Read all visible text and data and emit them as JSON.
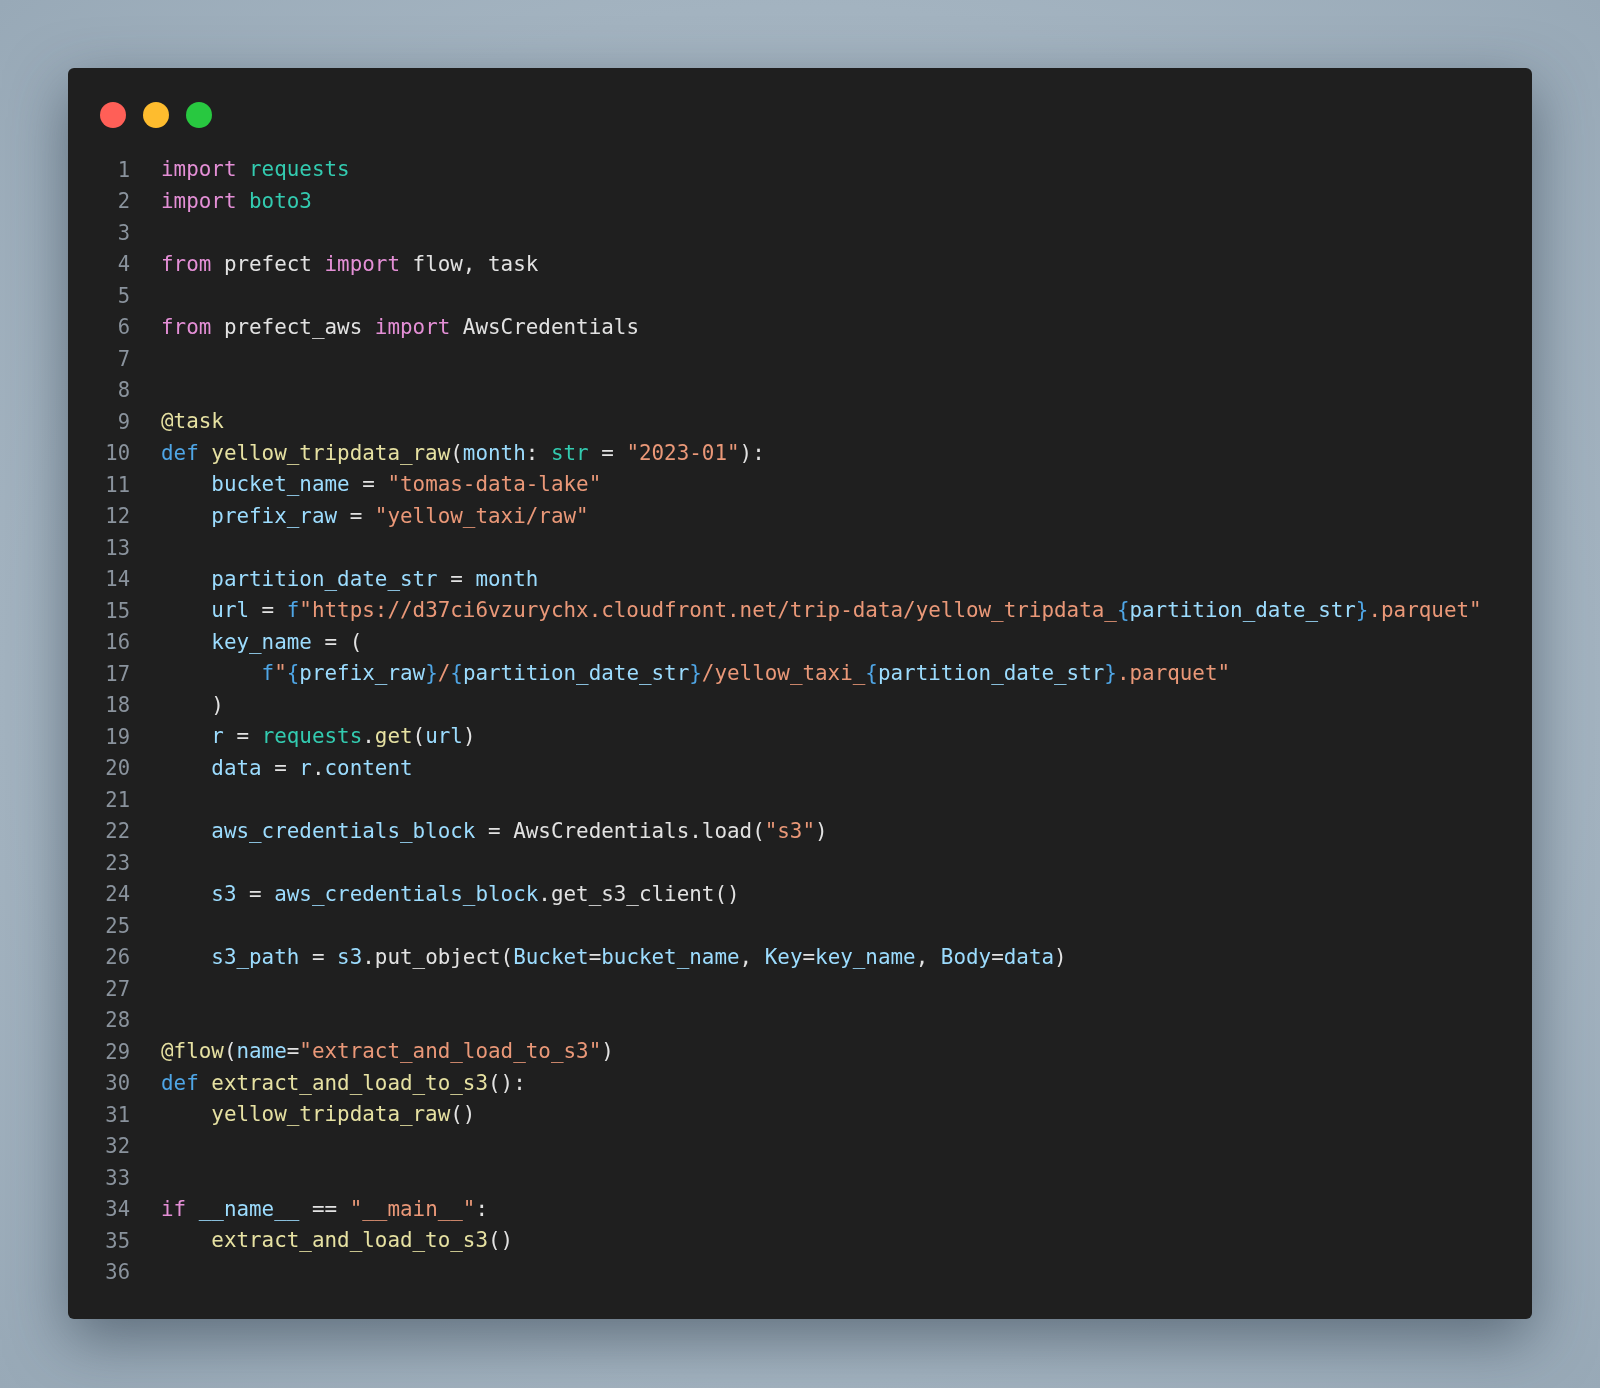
{
  "lines": [
    {
      "number": "1",
      "tokens": [
        {
          "kind": "keyword",
          "text": "import"
        },
        {
          "kind": "module",
          "text": " requests"
        }
      ]
    },
    {
      "number": "2",
      "tokens": [
        {
          "kind": "keyword",
          "text": "import"
        },
        {
          "kind": "module",
          "text": " boto3"
        }
      ]
    },
    {
      "number": "3"
    },
    {
      "number": "4",
      "tokens": [
        {
          "kind": "keyword",
          "text": "from"
        },
        {
          "kind": "plain",
          "text": " prefect "
        },
        {
          "kind": "keyword",
          "text": "import"
        },
        {
          "kind": "plain",
          "text": " flow, task"
        }
      ]
    },
    {
      "number": "5"
    },
    {
      "number": "6",
      "tokens": [
        {
          "kind": "keyword",
          "text": "from"
        },
        {
          "kind": "plain",
          "text": " prefect_aws "
        },
        {
          "kind": "keyword",
          "text": "import"
        },
        {
          "kind": "plain",
          "text": " AwsCredentials"
        }
      ]
    },
    {
      "number": "7"
    },
    {
      "number": "8"
    },
    {
      "number": "9",
      "tokens": [
        {
          "kind": "function",
          "text": "@task"
        }
      ]
    },
    {
      "number": "10",
      "tokens": [
        {
          "kind": "storage",
          "text": "def"
        },
        {
          "kind": "function",
          "text": " yellow_tripdata_raw"
        },
        {
          "kind": "plain",
          "text": "("
        },
        {
          "kind": "variable",
          "text": "month"
        },
        {
          "kind": "plain",
          "text": ":"
        },
        {
          "kind": "module",
          "text": " str"
        },
        {
          "kind": "plain",
          "text": " = "
        },
        {
          "kind": "string",
          "text": "\"2023-01\""
        },
        {
          "kind": "plain",
          "text": "):"
        }
      ]
    },
    {
      "number": "11",
      "tokens": [
        {
          "kind": "variable",
          "text": "    bucket_name"
        },
        {
          "kind": "plain",
          "text": " = "
        },
        {
          "kind": "string",
          "text": "\"tomas-data-lake\""
        }
      ]
    },
    {
      "number": "12",
      "tokens": [
        {
          "kind": "variable",
          "text": "    prefix_raw"
        },
        {
          "kind": "plain",
          "text": " = "
        },
        {
          "kind": "string",
          "text": "\"yellow_taxi/raw\""
        }
      ]
    },
    {
      "number": "13"
    },
    {
      "number": "14",
      "tokens": [
        {
          "kind": "variable",
          "text": "    partition_date_str"
        },
        {
          "kind": "plain",
          "text": " = "
        },
        {
          "kind": "variable",
          "text": "month"
        }
      ]
    },
    {
      "number": "15",
      "tokens": [
        {
          "kind": "variable",
          "text": "    url"
        },
        {
          "kind": "plain",
          "text": " = "
        },
        {
          "kind": "storage",
          "text": "f"
        },
        {
          "kind": "string",
          "text": "\"https://d37ci6vzurychx.cloudfront.net/trip-data/yellow_tripdata_"
        },
        {
          "kind": "storage",
          "text": "{"
        },
        {
          "kind": "variable",
          "text": "partition_date_str"
        },
        {
          "kind": "storage",
          "text": "}"
        },
        {
          "kind": "string",
          "text": ".parquet\""
        }
      ]
    },
    {
      "number": "16",
      "tokens": [
        {
          "kind": "variable",
          "text": "    key_name"
        },
        {
          "kind": "plain",
          "text": " = ("
        }
      ]
    },
    {
      "number": "17",
      "tokens": [
        {
          "kind": "storage",
          "text": "        f"
        },
        {
          "kind": "string",
          "text": "\""
        },
        {
          "kind": "storage",
          "text": "{"
        },
        {
          "kind": "variable",
          "text": "prefix_raw"
        },
        {
          "kind": "storage",
          "text": "}"
        },
        {
          "kind": "string",
          "text": "/"
        },
        {
          "kind": "storage",
          "text": "{"
        },
        {
          "kind": "variable",
          "text": "partition_date_str"
        },
        {
          "kind": "storage",
          "text": "}"
        },
        {
          "kind": "string",
          "text": "/yellow_taxi_"
        },
        {
          "kind": "storage",
          "text": "{"
        },
        {
          "kind": "variable",
          "text": "partition_date_str"
        },
        {
          "kind": "storage",
          "text": "}"
        },
        {
          "kind": "string",
          "text": ".parquet\""
        }
      ]
    },
    {
      "number": "18",
      "tokens": [
        {
          "kind": "plain",
          "text": "    )"
        }
      ]
    },
    {
      "number": "19",
      "tokens": [
        {
          "kind": "variable",
          "text": "    r"
        },
        {
          "kind": "plain",
          "text": " = "
        },
        {
          "kind": "module",
          "text": "requests"
        },
        {
          "kind": "plain",
          "text": "."
        },
        {
          "kind": "function",
          "text": "get"
        },
        {
          "kind": "plain",
          "text": "("
        },
        {
          "kind": "variable",
          "text": "url"
        },
        {
          "kind": "plain",
          "text": ")"
        }
      ]
    },
    {
      "number": "20",
      "tokens": [
        {
          "kind": "variable",
          "text": "    data"
        },
        {
          "kind": "plain",
          "text": " = "
        },
        {
          "kind": "variable",
          "text": "r"
        },
        {
          "kind": "plain",
          "text": "."
        },
        {
          "kind": "variable",
          "text": "content"
        }
      ]
    },
    {
      "number": "21"
    },
    {
      "number": "22",
      "tokens": [
        {
          "kind": "variable",
          "text": "    aws_credentials_block"
        },
        {
          "kind": "plain",
          "text": " = AwsCredentials.load("
        },
        {
          "kind": "string",
          "text": "\"s3\""
        },
        {
          "kind": "plain",
          "text": ")"
        }
      ]
    },
    {
      "number": "23"
    },
    {
      "number": "24",
      "tokens": [
        {
          "kind": "variable",
          "text": "    s3"
        },
        {
          "kind": "plain",
          "text": " = "
        },
        {
          "kind": "variable",
          "text": "aws_credentials_block"
        },
        {
          "kind": "plain",
          "text": ".get_s3_client()"
        }
      ]
    },
    {
      "number": "25"
    },
    {
      "number": "26",
      "tokens": [
        {
          "kind": "variable",
          "text": "    s3_path"
        },
        {
          "kind": "plain",
          "text": " = "
        },
        {
          "kind": "variable",
          "text": "s3"
        },
        {
          "kind": "plain",
          "text": ".put_object("
        },
        {
          "kind": "variable",
          "text": "Bucket"
        },
        {
          "kind": "plain",
          "text": "="
        },
        {
          "kind": "variable",
          "text": "bucket_name"
        },
        {
          "kind": "plain",
          "text": ","
        },
        {
          "kind": "variable",
          "text": " Key"
        },
        {
          "kind": "plain",
          "text": "="
        },
        {
          "kind": "variable",
          "text": "key_name"
        },
        {
          "kind": "plain",
          "text": ","
        },
        {
          "kind": "variable",
          "text": " Body"
        },
        {
          "kind": "plain",
          "text": "="
        },
        {
          "kind": "variable",
          "text": "data"
        },
        {
          "kind": "plain",
          "text": ")"
        }
      ]
    },
    {
      "number": "27"
    },
    {
      "number": "28"
    },
    {
      "number": "29",
      "tokens": [
        {
          "kind": "function",
          "text": "@flow"
        },
        {
          "kind": "plain",
          "text": "("
        },
        {
          "kind": "variable",
          "text": "name"
        },
        {
          "kind": "plain",
          "text": "="
        },
        {
          "kind": "string",
          "text": "\"extract_and_load_to_s3\""
        },
        {
          "kind": "plain",
          "text": ")"
        }
      ]
    },
    {
      "number": "30",
      "tokens": [
        {
          "kind": "storage",
          "text": "def"
        },
        {
          "kind": "function",
          "text": " extract_and_load_to_s3"
        },
        {
          "kind": "plain",
          "text": "():"
        }
      ]
    },
    {
      "number": "31",
      "tokens": [
        {
          "kind": "function",
          "text": "    yellow_tripdata_raw"
        },
        {
          "kind": "plain",
          "text": "()"
        }
      ]
    },
    {
      "number": "32"
    },
    {
      "number": "33"
    },
    {
      "number": "34",
      "tokens": [
        {
          "kind": "keyword",
          "text": "if"
        },
        {
          "kind": "variable",
          "text": " __name__"
        },
        {
          "kind": "plain",
          "text": " == "
        },
        {
          "kind": "string",
          "text": "\"__main__\""
        },
        {
          "kind": "plain",
          "text": ":"
        }
      ]
    },
    {
      "number": "35",
      "tokens": [
        {
          "kind": "function",
          "text": "    extract_and_load_to_s3"
        },
        {
          "kind": "plain",
          "text": "()"
        }
      ]
    },
    {
      "number": "36"
    }
  ]
}
